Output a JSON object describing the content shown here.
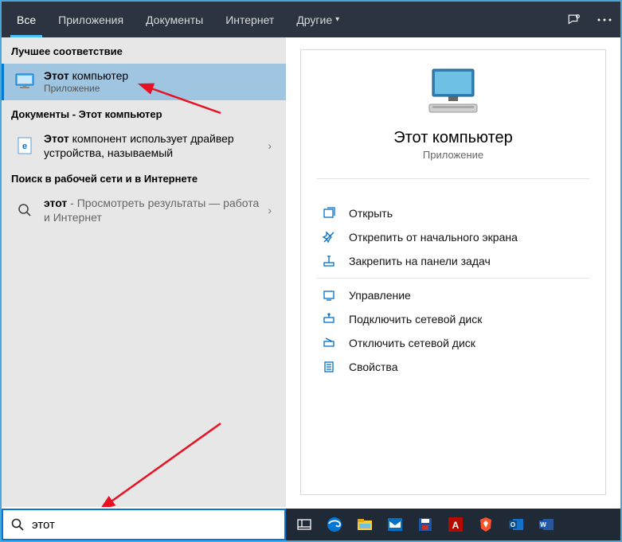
{
  "header": {
    "tabs": {
      "all": "Все",
      "apps": "Приложения",
      "docs": "Документы",
      "web": "Интернет",
      "more": "Другие"
    }
  },
  "left": {
    "best_match": "Лучшее соответствие",
    "result1": {
      "title_bold": "Этот",
      "title_rest": " компьютер",
      "sub": "Приложение"
    },
    "docs_header": "Документы - Этот компьютер",
    "result2": {
      "title_bold": "Этот",
      "title_rest": " компонент использует драйвер устройства, называемый"
    },
    "web_header": "Поиск в рабочей сети и в Интернете",
    "result3": {
      "title_bold": "этот",
      "title_rest": " - Просмотреть результаты — работа и Интернет"
    }
  },
  "right": {
    "title": "Этот компьютер",
    "sub": "Приложение",
    "actions": {
      "open": "Открыть",
      "unpin_start": "Открепить от начального экрана",
      "pin_taskbar": "Закрепить на панели задач",
      "manage": "Управление",
      "map_drive": "Подключить сетевой диск",
      "disconnect_drive": "Отключить сетевой диск",
      "properties": "Свойства"
    }
  },
  "search": {
    "value": "этот"
  }
}
